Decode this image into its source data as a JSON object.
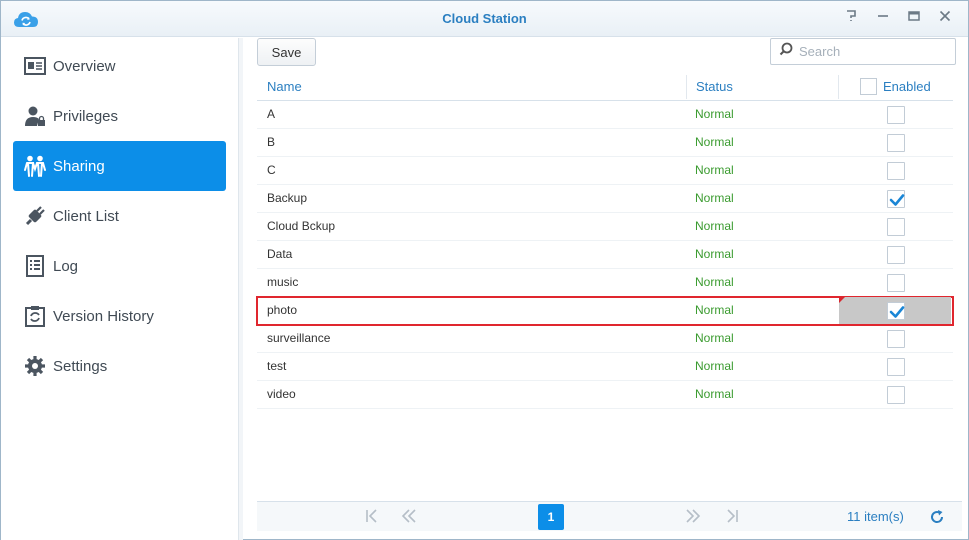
{
  "window": {
    "title": "Cloud Station",
    "icons": [
      "cloud-sync-icon",
      "help-icon",
      "minimize-icon",
      "maximize-icon",
      "close-icon"
    ]
  },
  "sidebar": {
    "items": [
      {
        "label": "Overview",
        "icon": "overview-icon",
        "active": false
      },
      {
        "label": "Privileges",
        "icon": "user-lock-icon",
        "active": false
      },
      {
        "label": "Sharing",
        "icon": "people-icon",
        "active": true
      },
      {
        "label": "Client List",
        "icon": "plug-icon",
        "active": false
      },
      {
        "label": "Log",
        "icon": "log-icon",
        "active": false
      },
      {
        "label": "Version History",
        "icon": "version-history-icon",
        "active": false
      },
      {
        "label": "Settings",
        "icon": "gear-icon",
        "active": false
      }
    ]
  },
  "toolbar": {
    "save_label": "Save",
    "search_placeholder": "Search"
  },
  "grid": {
    "columns": {
      "name": "Name",
      "status": "Status",
      "enabled": "Enabled"
    },
    "rows": [
      {
        "name": "A",
        "status": "Normal",
        "enabled": false
      },
      {
        "name": "B",
        "status": "Normal",
        "enabled": false
      },
      {
        "name": "C",
        "status": "Normal",
        "enabled": false
      },
      {
        "name": "Backup",
        "status": "Normal",
        "enabled": true
      },
      {
        "name": "Cloud Bckup",
        "status": "Normal",
        "enabled": false
      },
      {
        "name": "Data",
        "status": "Normal",
        "enabled": false
      },
      {
        "name": "music",
        "status": "Normal",
        "enabled": false
      },
      {
        "name": "photo",
        "status": "Normal",
        "enabled": true
      },
      {
        "name": "surveillance",
        "status": "Normal",
        "enabled": false
      },
      {
        "name": "test",
        "status": "Normal",
        "enabled": false
      },
      {
        "name": "video",
        "status": "Normal",
        "enabled": false
      }
    ]
  },
  "pager": {
    "current_page": "1",
    "item_count": "11 item(s)"
  },
  "colors": {
    "accent": "#0c8ee8",
    "title": "#2b7fc1",
    "status_ok": "#3a9b2f",
    "highlight": "#e0262e"
  }
}
